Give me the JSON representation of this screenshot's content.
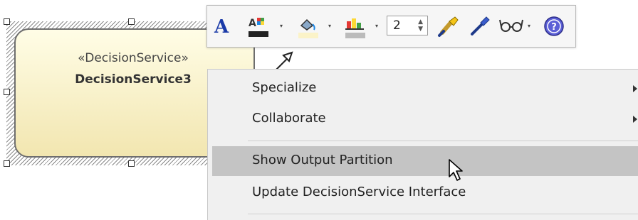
{
  "element": {
    "stereotype": "«DecisionService»",
    "name": "DecisionService3"
  },
  "toolbar": {
    "font_icon": "font-icon",
    "fill_icon": "fill-color-icon",
    "line_icon": "line-color-icon",
    "text_icon": "text-color-icon",
    "line_width_value": "2",
    "paint_icon": "paintbrush-icon",
    "pick_icon": "eyedropper-icon",
    "glasses_icon": "glasses-icon",
    "help_icon": "help-icon",
    "font_glyph": "A"
  },
  "menu": {
    "items": [
      {
        "label": "Specialize",
        "has_submenu": true
      },
      {
        "label": "Collaborate",
        "has_submenu": true
      },
      {
        "label": "Show Output Partition",
        "has_submenu": false,
        "highlighted": true
      },
      {
        "label": "Update DecisionService Interface",
        "has_submenu": false
      }
    ]
  },
  "colors": {
    "element_fill_top": "#fffde6",
    "element_fill_bottom": "#f2e6b0",
    "menu_bg": "#f0f0f0",
    "menu_highlight": "#c4c4c4"
  }
}
